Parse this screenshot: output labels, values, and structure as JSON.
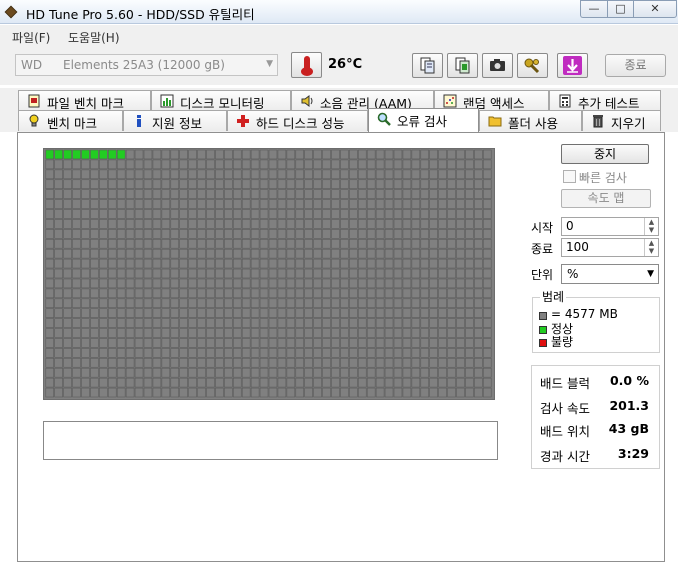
{
  "window": {
    "title": "HD Tune Pro 5.60 - HDD/SSD  유틸리티",
    "min": "—",
    "max": "□",
    "close": "✕"
  },
  "menu": [
    "파일(F)",
    "도움말(H)"
  ],
  "toolbar": {
    "drive_brand": "WD",
    "drive_model": "Elements 25A3 (12000 gB)",
    "temperature": "26°C",
    "exit_label": "종료"
  },
  "tabs_row1": [
    "파일 벤치 마크",
    "디스크 모니터링",
    "소음 관리 (AAM)",
    "랜덤 액세스",
    "추가 테스트"
  ],
  "tabs_row2": [
    "벤치 마크",
    "지원 정보",
    "하드 디스크 성능",
    "오류 검사",
    "폴더 사용",
    "지우기"
  ],
  "controls": {
    "stop_label": "중지",
    "quick_scan_label": "빠른 검사",
    "speed_map_label": "속도 맵",
    "start_label": "시작",
    "start_value": "0",
    "end_label": "종료",
    "end_value": "100",
    "unit_label": "단위",
    "unit_value": "%"
  },
  "legend": {
    "title": "범례",
    "block_size": "= 4577 MB",
    "ok": "정상",
    "bad": "불량"
  },
  "stats": {
    "bad_blocks_label": "배드 블럭",
    "bad_blocks_value": "0.0 %",
    "scan_speed_label": "검사 속도",
    "scan_speed_value": "201.3",
    "position_label": "배드 위치",
    "position_value": "43 gB",
    "elapsed_label": "경과 시간",
    "elapsed_value": "3:29"
  },
  "scan_grid": {
    "columns": 50,
    "rows": 25,
    "scanned_blocks": 9
  },
  "colors": {
    "block_pending": "#808080",
    "block_ok": "#22cc22",
    "block_bad": "#e01010"
  }
}
